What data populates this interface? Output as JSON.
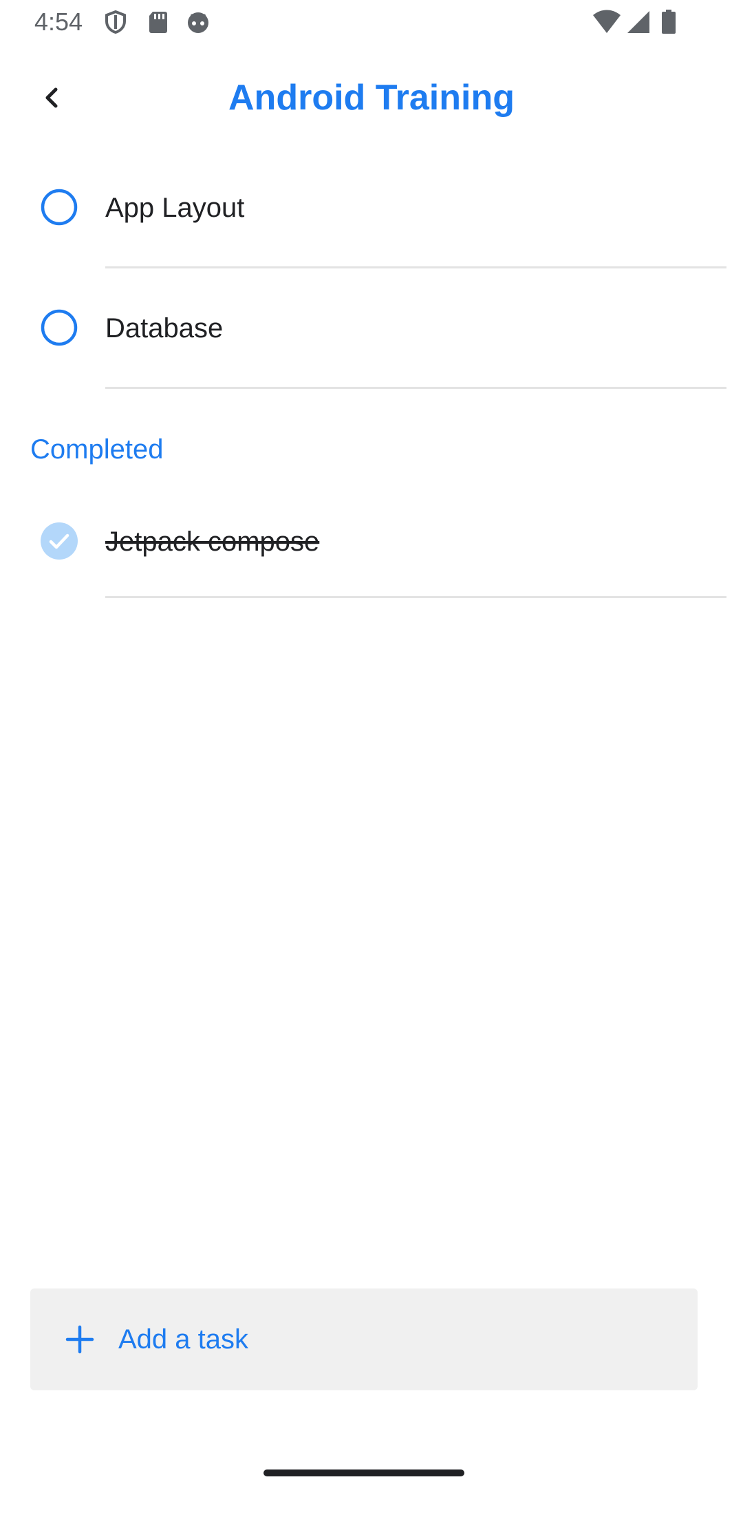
{
  "status_bar": {
    "time": "4:54",
    "icons": [
      "shield-icon",
      "sd-card-icon",
      "android-robot-icon",
      "wifi-icon",
      "cell-signal-icon",
      "battery-icon"
    ]
  },
  "app_bar": {
    "title": "Android Training",
    "back_icon": "chevron-left-icon"
  },
  "tasks": {
    "pending": [
      {
        "label": "App Layout",
        "completed": false
      },
      {
        "label": "Database",
        "completed": false
      }
    ],
    "completed_header": "Completed",
    "completed": [
      {
        "label": "Jetpack compose",
        "completed": true
      }
    ]
  },
  "add_task": {
    "label": "Add a task",
    "icon": "plus-icon"
  },
  "colors": {
    "accent": "#1e7cf0",
    "completed_check": "#b3d7fa",
    "divider": "#e3e3e3",
    "add_bar_bg": "#f0f0f0"
  }
}
